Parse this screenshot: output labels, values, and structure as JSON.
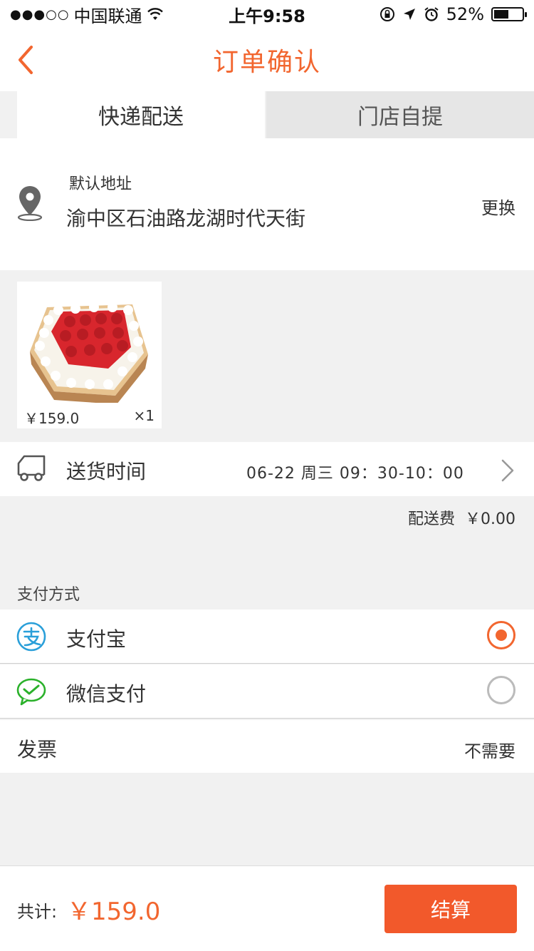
{
  "status_bar": {
    "signal": "●●●○○",
    "carrier": "中国联通",
    "time": "上午9:58",
    "battery_percent": "52%",
    "battery_level": 0.52
  },
  "nav": {
    "title": "订单确认"
  },
  "tabs": [
    {
      "label": "快递配送",
      "active": true
    },
    {
      "label": "门店自提",
      "active": false
    }
  ],
  "address": {
    "label": "默认地址",
    "text": "渝中区石油路龙湖时代天街",
    "change": "更换"
  },
  "product": {
    "price": "￥159.0",
    "quantity": "×1"
  },
  "delivery": {
    "label": "送货时间",
    "value": "06-22 周三 09：30-10：00",
    "fee_label": "配送费",
    "fee_value": "￥0.00"
  },
  "payment": {
    "heading": "支付方式",
    "methods": [
      {
        "label": "支付宝",
        "selected": true
      },
      {
        "label": "微信支付",
        "selected": false
      }
    ]
  },
  "invoice": {
    "label": "发票",
    "value": "不需要"
  },
  "footer": {
    "total_label": "共计:",
    "total_value": "￥159.0",
    "checkout": "结算"
  },
  "colors": {
    "accent": "#f2662f",
    "button": "#f2592b",
    "background": "#f1f1f1"
  }
}
